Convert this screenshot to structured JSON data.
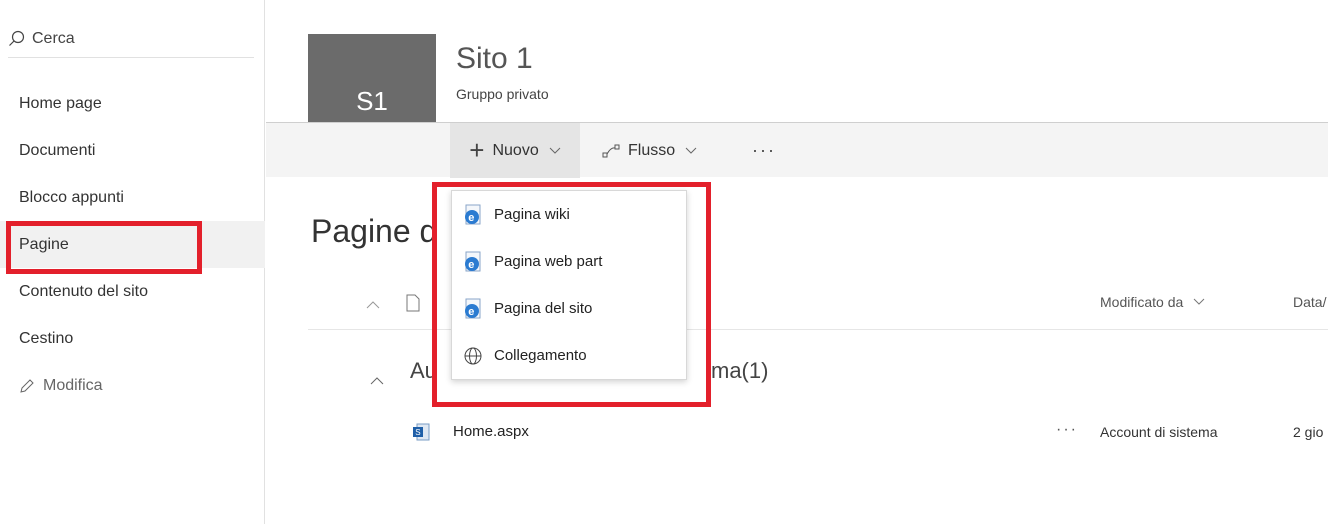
{
  "leftnav": {
    "search_placeholder": "Cerca",
    "items": [
      {
        "label": "Home page"
      },
      {
        "label": "Documenti"
      },
      {
        "label": "Blocco appunti"
      },
      {
        "label": "Pagine",
        "selected": true
      },
      {
        "label": "Contenuto del sito"
      },
      {
        "label": "Cestino"
      }
    ],
    "edit_label": "Modifica"
  },
  "site": {
    "logo_text": "S1",
    "title": "Sito 1",
    "subtitle": "Gruppo privato"
  },
  "commandbar": {
    "new_label": "Nuovo",
    "flow_label": "Flusso",
    "more_label": "···"
  },
  "content": {
    "page_title_fragment": "Pagine d",
    "columns": {
      "modified_by": "Modificato da",
      "date_fragment": "Data/"
    },
    "group": {
      "fragment_left": "Au",
      "fragment_right": "ma(1)"
    },
    "rows": [
      {
        "name": "Home.aspx",
        "more": "···",
        "modified_by": "Account di sistema",
        "date_fragment": "2 gio"
      }
    ]
  },
  "new_menu": {
    "items": [
      {
        "label": "Pagina wiki",
        "icon": "ie-page-icon"
      },
      {
        "label": "Pagina web part",
        "icon": "ie-page-icon"
      },
      {
        "label": "Pagina del sito",
        "icon": "ie-page-icon"
      },
      {
        "label": "Collegamento",
        "icon": "globe-icon"
      }
    ]
  },
  "colors": {
    "highlight": "#e3202b",
    "logo_bg": "#6b6b6b",
    "selected_nav_bg": "#f1f1f1"
  }
}
